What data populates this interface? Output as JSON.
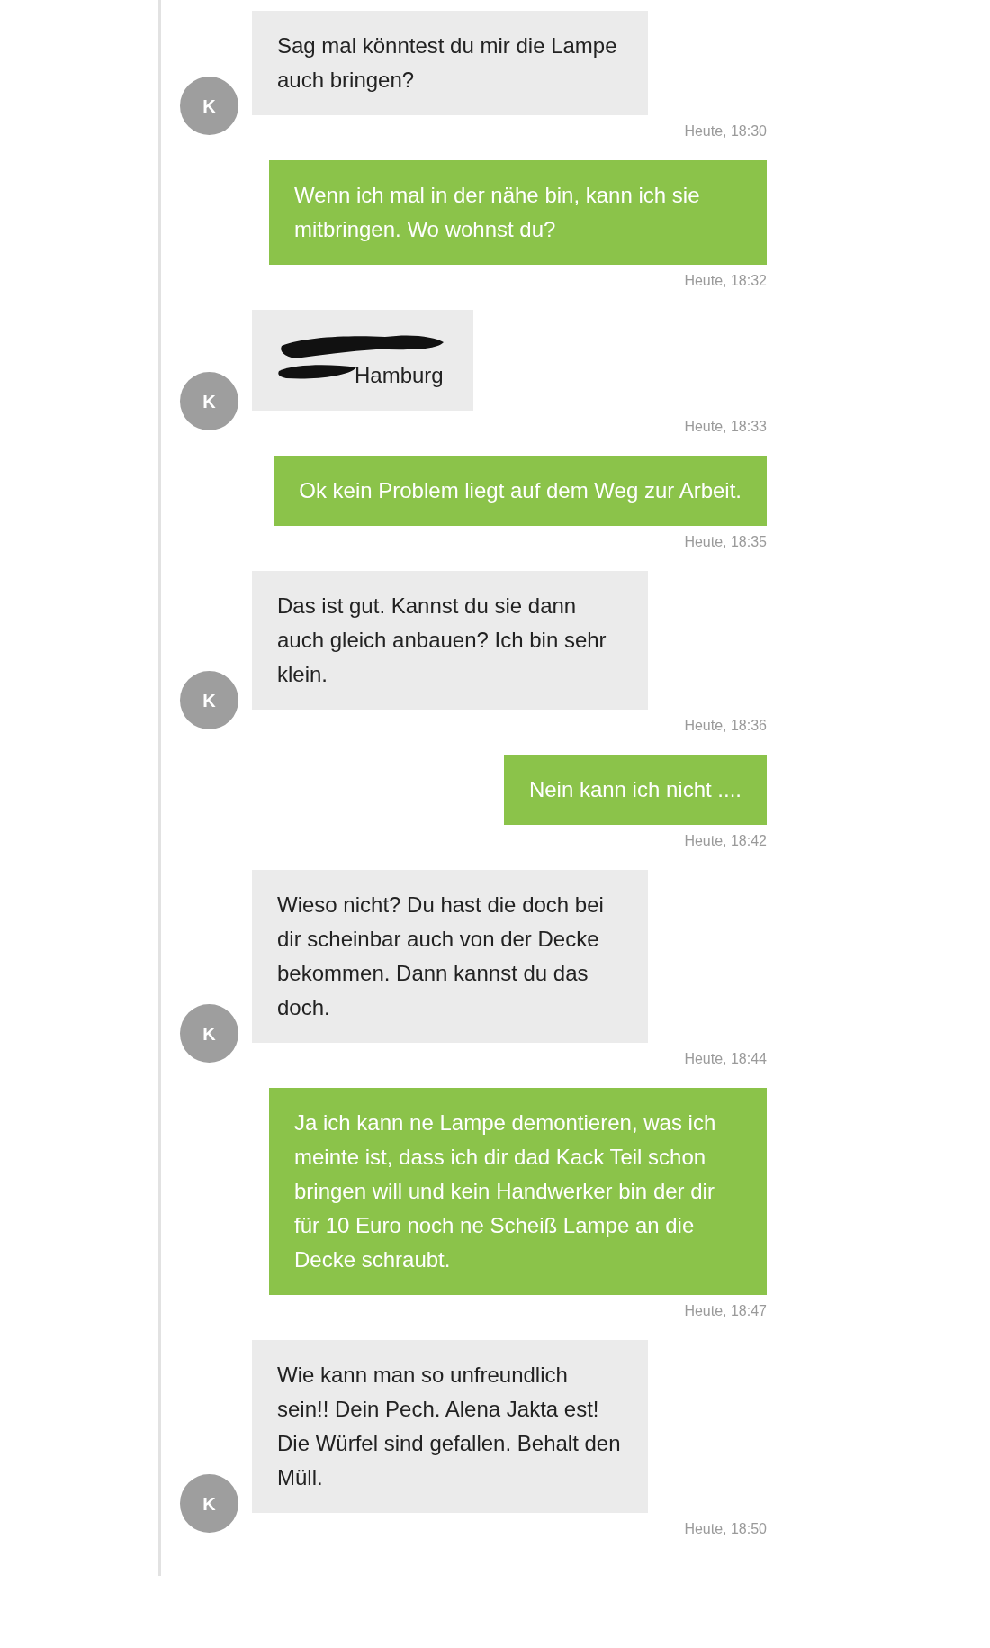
{
  "messages": [
    {
      "kind": "received",
      "avatar": "K",
      "text": "Sag mal könntest du mir die Lampe auch bringen?",
      "time": "Heute, 18:30"
    },
    {
      "kind": "sent",
      "text": "Wenn ich mal in der nähe bin, kann ich sie mitbringen. Wo wohnst du?",
      "time": "Heute, 18:32"
    },
    {
      "kind": "received",
      "avatar": "K",
      "redacted": true,
      "text": "Hamburg",
      "time": "Heute, 18:33"
    },
    {
      "kind": "sent",
      "text": "Ok kein Problem liegt auf dem Weg zur Arbeit.",
      "time": "Heute, 18:35"
    },
    {
      "kind": "received",
      "avatar": "K",
      "text": "Das ist gut. Kannst du sie dann auch gleich anbauen? Ich bin sehr klein.",
      "time": "Heute, 18:36"
    },
    {
      "kind": "sent",
      "text": "Nein kann ich nicht ....",
      "time": "Heute, 18:42"
    },
    {
      "kind": "received",
      "avatar": "K",
      "text": "Wieso nicht? Du hast die doch bei dir scheinbar auch von der Decke bekommen. Dann kannst du das doch.",
      "time": "Heute, 18:44"
    },
    {
      "kind": "sent",
      "text": "Ja ich kann ne Lampe demontieren, was ich meinte ist, dass ich dir dad Kack Teil schon bringen will und kein Handwerker bin der dir für 10 Euro noch ne Scheiß Lampe an die Decke schraubt.",
      "time": "Heute, 18:47"
    },
    {
      "kind": "received",
      "avatar": "K",
      "text": "Wie kann man so unfreundlich sein!! Dein Pech. Alena Jakta est! Die Würfel sind gefallen. Behalt den Müll.",
      "time": "Heute, 18:50"
    }
  ]
}
